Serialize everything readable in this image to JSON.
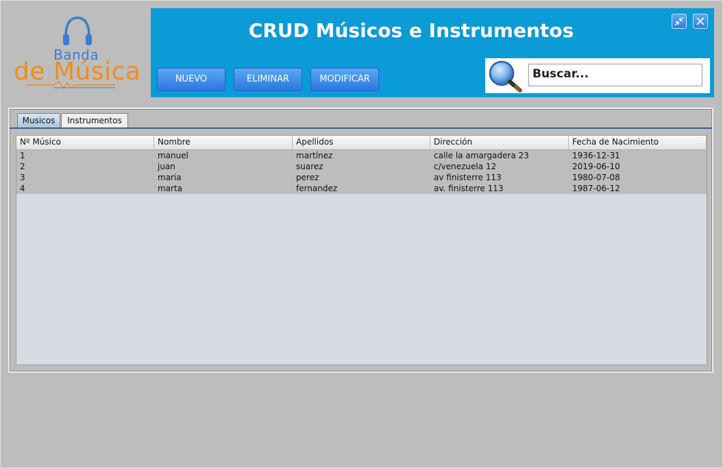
{
  "logo": {
    "line1": "Banda",
    "line2": "de Música",
    "brand_blue": "#3a7dd4",
    "brand_orange": "#f08d1a"
  },
  "header": {
    "title": "CRUD Músicos e Instrumentos",
    "bg_color": "#0b9bd6",
    "window_buttons": [
      {
        "name": "minimize-icon"
      },
      {
        "name": "close-icon"
      }
    ]
  },
  "toolbar": {
    "new_label": "NUEVO",
    "delete_label": "ELIMINAR",
    "modify_label": "MODIFICAR"
  },
  "search": {
    "value": "Buscar...",
    "icon": "magnifier-icon"
  },
  "tabs": [
    {
      "label": "Musicos",
      "active": true
    },
    {
      "label": "Instrumentos",
      "active": false
    }
  ],
  "table": {
    "columns": [
      "Nº Músico",
      "Nombre",
      "Apellidos",
      "Dirección",
      "Fecha de Nacimiento"
    ],
    "rows": [
      [
        "1",
        "manuel",
        "martínez",
        "calle la amargadera 23",
        "1936-12-31"
      ],
      [
        "2",
        "juan",
        "suarez",
        "c/venezuela 12",
        "2019-06-10"
      ],
      [
        "3",
        "maria",
        "perez",
        "av finisterre 113",
        "1980-07-08"
      ],
      [
        "4",
        "marta",
        "fernandez",
        "av. finisterre 113",
        "1987-06-12"
      ]
    ]
  }
}
